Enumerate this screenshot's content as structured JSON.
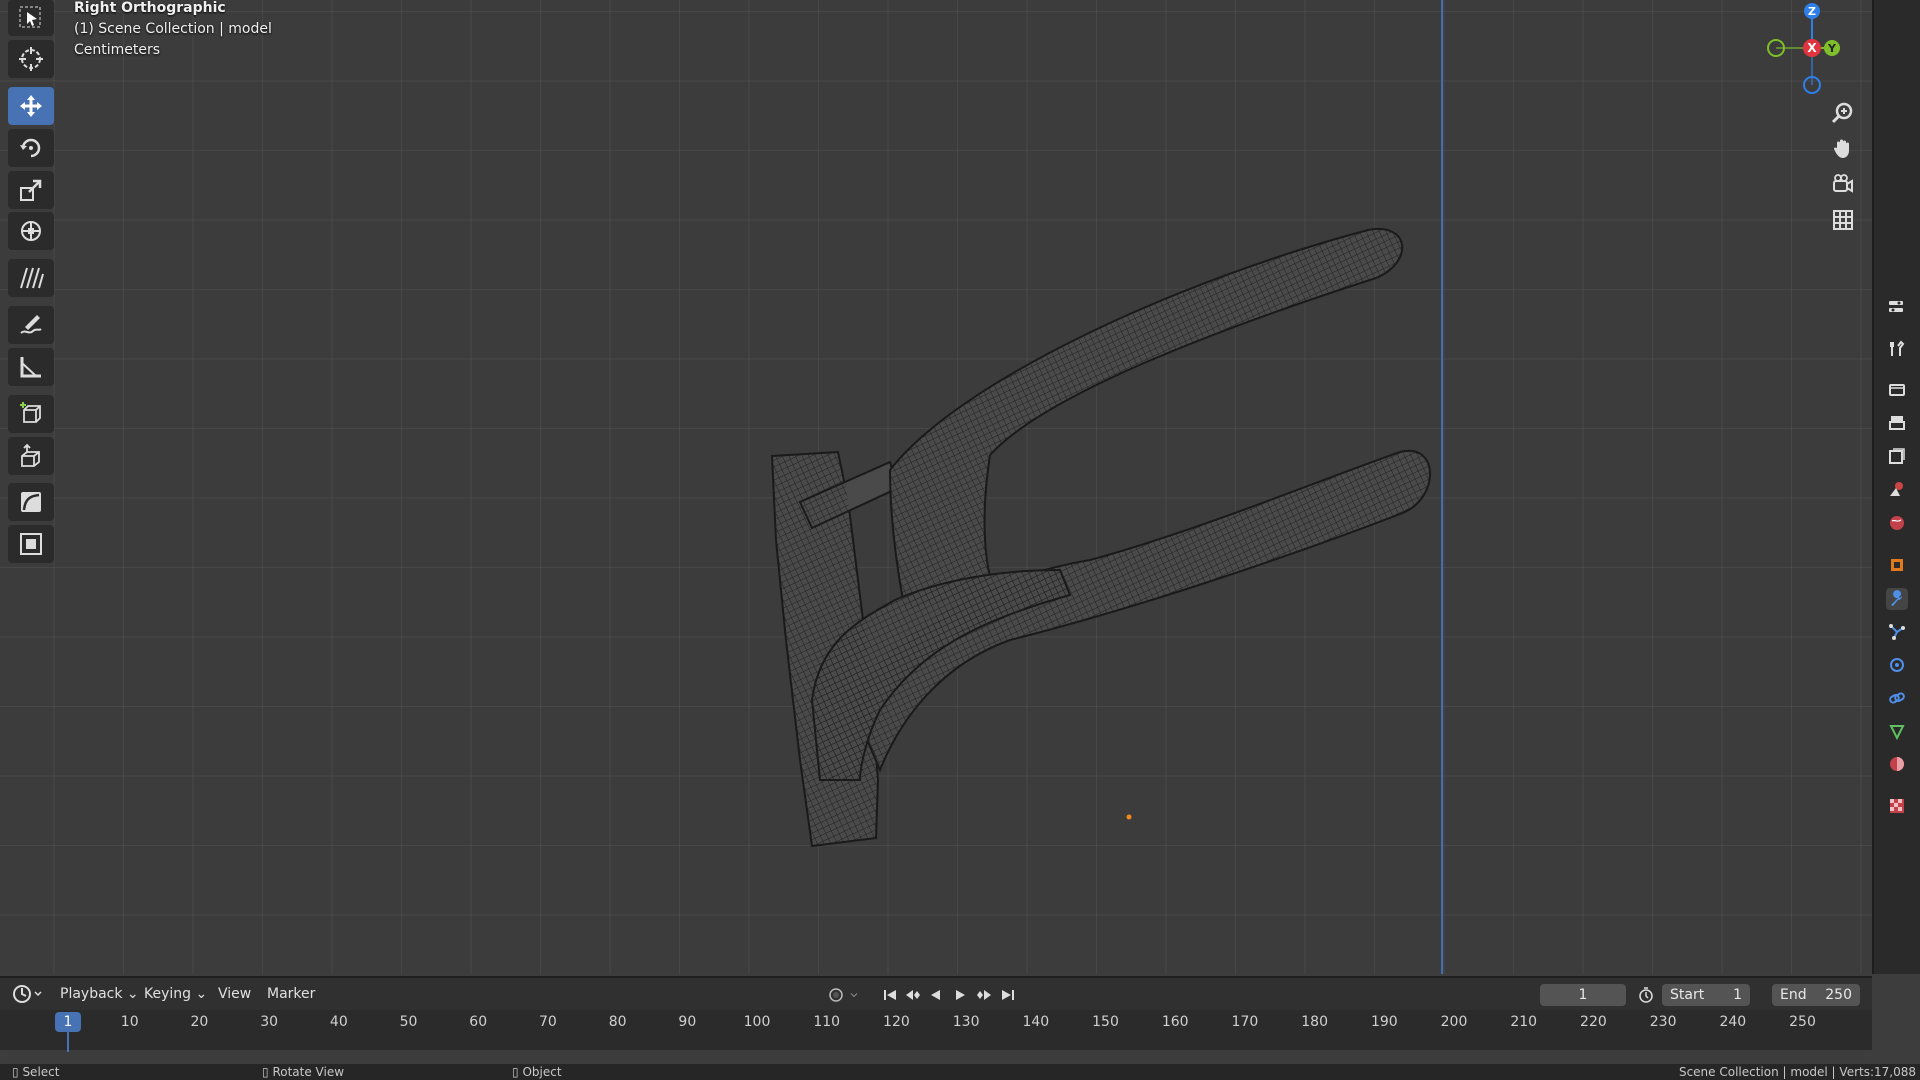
{
  "viewport": {
    "view_name": "Right Orthographic",
    "collection": "(1) Scene Collection | model",
    "units": "Centimeters"
  },
  "toolbar": {
    "tools": [
      {
        "name": "select-box",
        "icon": "select-box-icon",
        "active": false
      },
      {
        "name": "cursor",
        "icon": "cursor-icon",
        "active": false
      },
      {
        "name": "move",
        "icon": "move-icon",
        "active": true
      },
      {
        "name": "rotate",
        "icon": "rotate-icon",
        "active": false
      },
      {
        "name": "scale",
        "icon": "scale-icon",
        "active": false
      },
      {
        "name": "transform",
        "icon": "transform-icon",
        "active": false
      },
      {
        "name": "hatch",
        "icon": "hatch-icon",
        "active": false
      },
      {
        "name": "annotate",
        "icon": "annotate-icon",
        "active": false
      },
      {
        "name": "measure",
        "icon": "measure-icon",
        "active": false
      },
      {
        "name": "add-cube",
        "icon": "add-cube-icon",
        "active": false
      },
      {
        "name": "extrude",
        "icon": "extrude-icon",
        "active": false
      },
      {
        "name": "curve",
        "icon": "curve-icon",
        "active": false
      },
      {
        "name": "inset",
        "icon": "inset-icon",
        "active": false
      }
    ]
  },
  "gizmo": {
    "axis_z": "Z",
    "axis_x": "X",
    "axis_y": "Y",
    "colors": {
      "x": "#e0343f",
      "y": "#7fbf2a",
      "z": "#2f7fe8"
    }
  },
  "timeline": {
    "menus": {
      "editor": "",
      "playback": "Playback",
      "keying": "Keying",
      "view": "View",
      "marker": "Marker"
    },
    "current_frame": "1",
    "start_label": "Start",
    "start_value": "1",
    "end_label": "End",
    "end_value": "250",
    "ticks": [
      "10",
      "20",
      "30",
      "40",
      "50",
      "60",
      "70",
      "80",
      "90",
      "100",
      "110",
      "120",
      "130",
      "140",
      "150",
      "160",
      "170",
      "180",
      "190",
      "200",
      "210",
      "220",
      "230",
      "240",
      "250"
    ],
    "playhead": "1"
  },
  "status": {
    "select": "Select",
    "rotate_view": "Rotate View",
    "object": "Object",
    "right": "Scene Collection | model | Verts:17,088"
  },
  "accent": "#4772b3"
}
